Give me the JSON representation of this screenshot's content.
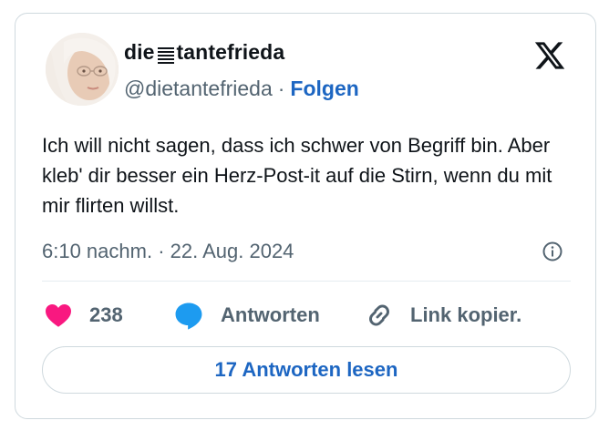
{
  "author": {
    "display_name_prefix": "die",
    "display_name_suffix": "tantefrieda",
    "handle": "@dietantefrieda",
    "separator": "·",
    "follow_label": "Folgen"
  },
  "tweet": {
    "text": "Ich will nicht sagen, dass ich schwer von Begriff bin. Aber kleb' dir besser ein Herz-Post-it auf die Stirn, wenn du mit mir flirten willst.",
    "timestamp": "6:10 nachm. · 22. Aug. 2024"
  },
  "actions": {
    "like_count": "238",
    "reply_label": "Antworten",
    "copy_link_label": "Link kopier."
  },
  "read_replies_label": "17 Antworten lesen",
  "icons": {
    "platform": "x-logo-icon",
    "info": "info-icon",
    "like": "heart-icon",
    "reply": "speech-bubble-icon",
    "copy": "link-icon",
    "name_glyph": "lines-glyph-icon"
  },
  "colors": {
    "text": "#0f1419",
    "muted": "#536471",
    "link": "#1d66c2",
    "heart": "#f91880",
    "reply_bubble": "#1d9bf0",
    "border": "#cfd9de"
  }
}
